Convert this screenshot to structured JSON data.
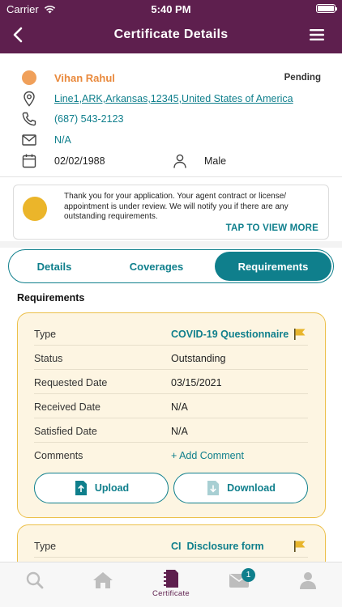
{
  "status_bar": {
    "carrier": "Carrier",
    "time": "5:40 PM"
  },
  "header": {
    "title": "Certificate Details"
  },
  "profile": {
    "name": "Vihan Rahul",
    "status": "Pending",
    "address": "Line1,ARK,Arkansas,12345,United States of America",
    "phone": "(687) 543-2123",
    "email": "N/A",
    "dob": "02/02/1988",
    "gender": "Male"
  },
  "notice": {
    "text": "Thank you for your application. Your agent contract or license/ appointment is under review. We will notify you if there are any outstanding requirements.",
    "link": "TAP TO VIEW MORE"
  },
  "tabs": [
    {
      "label": "Details"
    },
    {
      "label": "Coverages"
    },
    {
      "label": "Requirements"
    }
  ],
  "requirements": {
    "title": "Requirements",
    "cards": [
      {
        "rows": [
          {
            "label": "Type",
            "value": "COVID-19 Questionnaire"
          },
          {
            "label": "Status",
            "value": "Outstanding"
          },
          {
            "label": "Requested Date",
            "value": "03/15/2021"
          },
          {
            "label": "Received Date",
            "value": "N/A"
          },
          {
            "label": "Satisfied Date",
            "value": "N/A"
          },
          {
            "label": "Comments",
            "value": "+ Add Comment"
          }
        ],
        "upload_label": "Upload",
        "download_label": "Download"
      },
      {
        "rows": [
          {
            "label": "Type",
            "value": "CI  Disclosure form"
          }
        ]
      }
    ]
  },
  "bottom_nav": {
    "certificate_label": "Certificate",
    "messages_badge": "1"
  },
  "colors": {
    "brand": "#5e1f4e",
    "accent": "#0f7f8c",
    "card_bg": "#fdf5e2",
    "card_border": "#ecc04a"
  }
}
